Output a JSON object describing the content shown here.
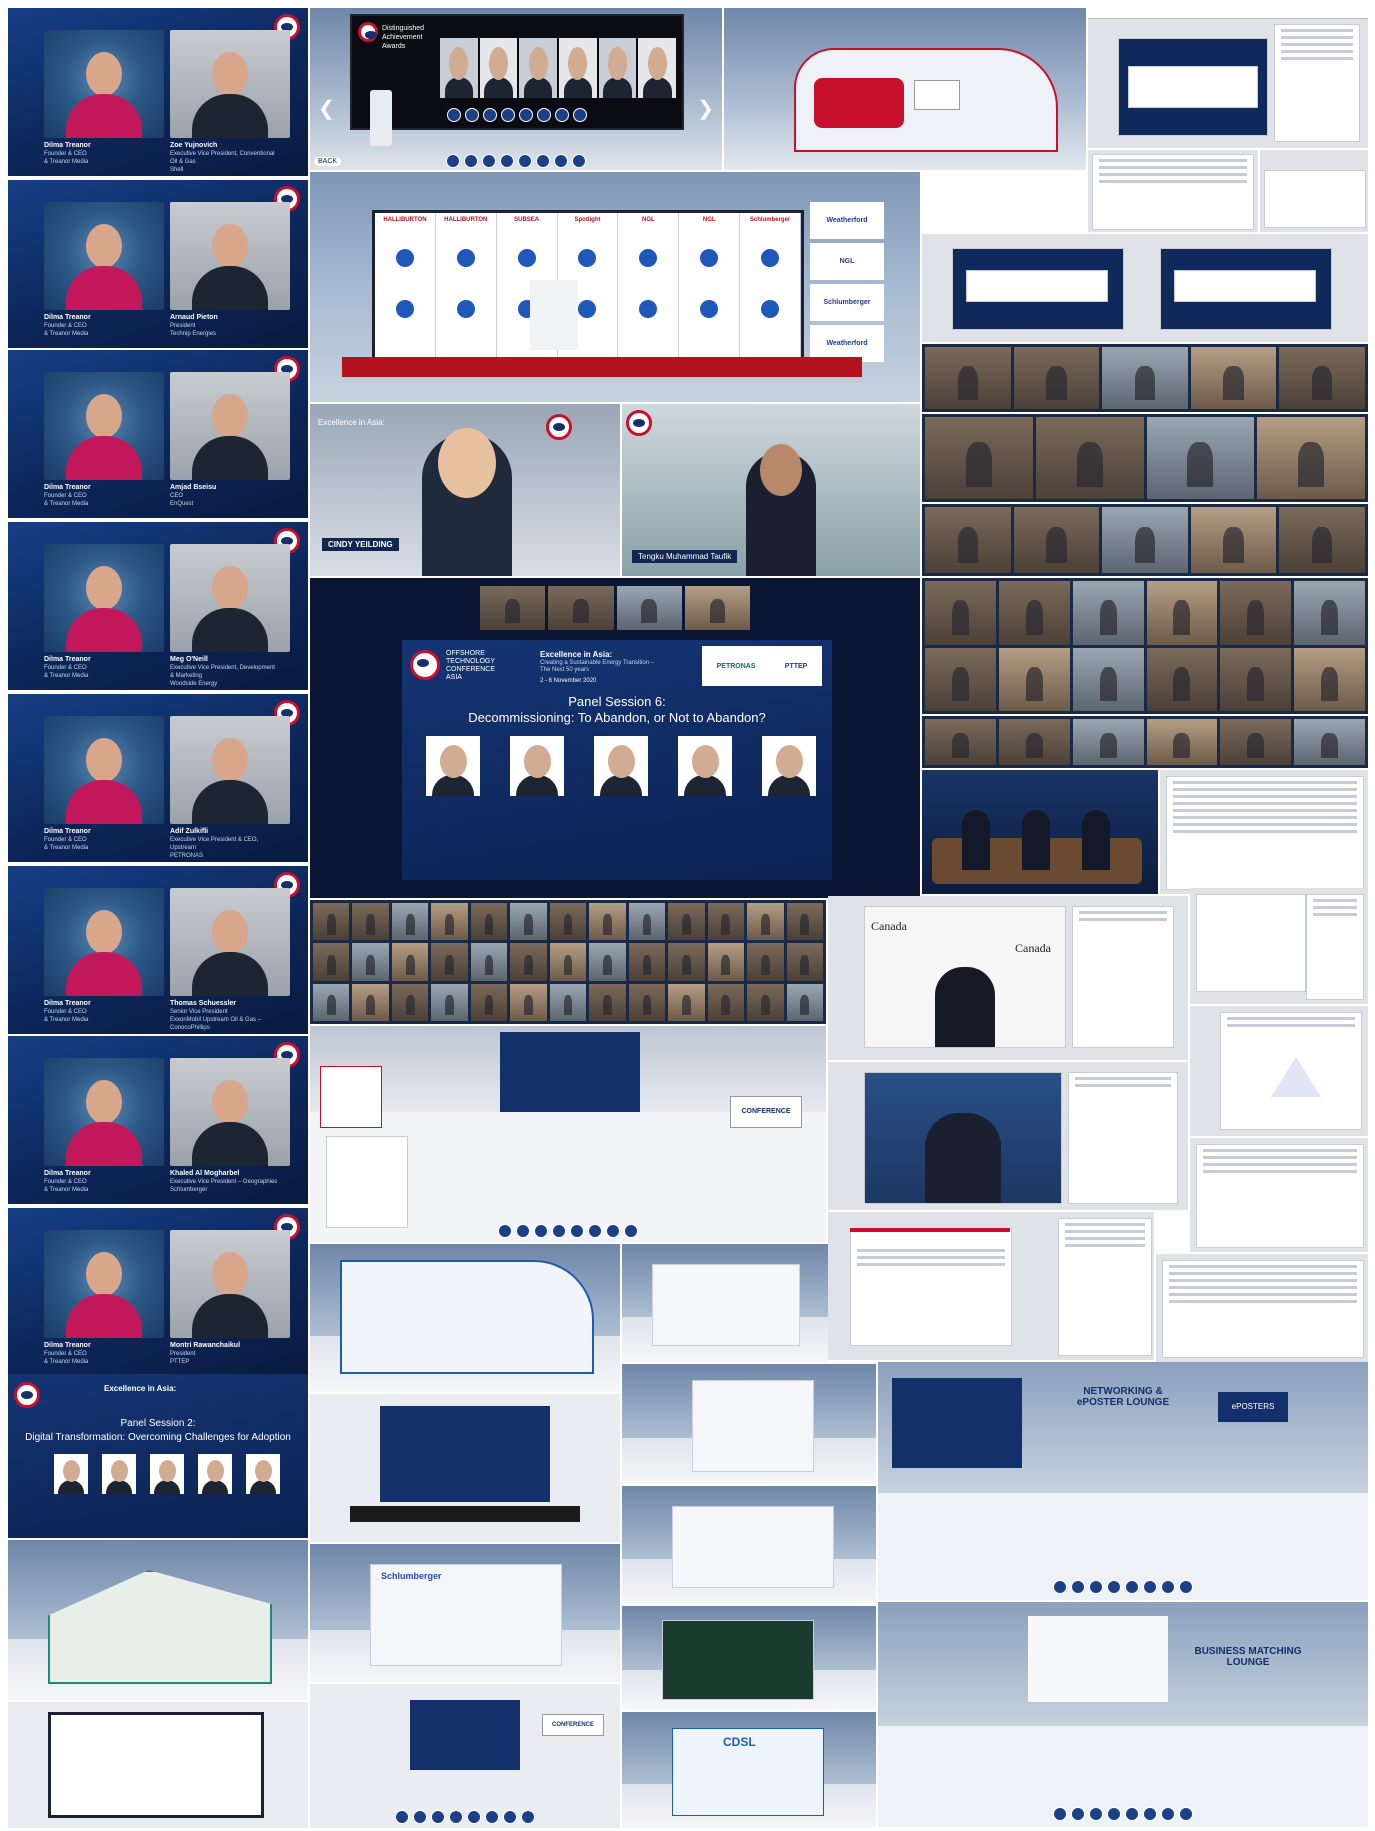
{
  "interviews": [
    {
      "host": "Dilma Treanor",
      "host_role": "Founder & CEO",
      "host_org": "& Treanor Media",
      "guest": "Zoe Yujnovich",
      "guest_role": "Executive Vice President, Conventional Oil & Gas",
      "guest_org": "Shell"
    },
    {
      "host": "Dilma Treanor",
      "host_role": "Founder & CEO",
      "host_org": "& Treanor Media",
      "guest": "Arnaud Pieton",
      "guest_role": "President",
      "guest_org": "Technip Energies"
    },
    {
      "host": "Dilma Treanor",
      "host_role": "Founder & CEO",
      "host_org": "& Treanor Media",
      "guest": "Amjad Bseisu",
      "guest_role": "CEO",
      "guest_org": "EnQuest"
    },
    {
      "host": "Dilma Treanor",
      "host_role": "Founder & CEO",
      "host_org": "& Treanor Media",
      "guest": "Meg O'Neill",
      "guest_role": "Executive Vice President, Development & Marketing",
      "guest_org": "Woodside Energy"
    },
    {
      "host": "Dilma Treanor",
      "host_role": "Founder & CEO",
      "host_org": "& Treanor Media",
      "guest": "Adif Zulkifli",
      "guest_role": "Executive Vice President & CEO, Upstream",
      "guest_org": "PETRONAS"
    },
    {
      "host": "Dilma Treanor",
      "host_role": "Founder & CEO",
      "host_org": "& Treanor Media",
      "guest": "Thomas Schuessler",
      "guest_role": "Senior Vice President",
      "guest_org": "ExxonMobil Upstream Oil & Gas – ConocoPhillips"
    },
    {
      "host": "Dilma Treanor",
      "host_role": "Founder & CEO",
      "host_org": "& Treanor Media",
      "guest": "Khaled Al Mogharbel",
      "guest_role": "Executive Vice President – Geographies",
      "guest_org": "Schlumberger"
    },
    {
      "host": "Dilma Treanor",
      "host_role": "Founder & CEO",
      "host_org": "& Treanor Media",
      "guest": "Montri Rawanchaikul",
      "guest_role": "President",
      "guest_org": "PTTEP"
    }
  ],
  "top_hall": {
    "banner": "Distinguished Achievement Awards",
    "back_label": "BACK"
  },
  "stage_wall": {
    "columns": [
      "HALLIBURTON",
      "HALLIBURTON",
      "SUBSEA",
      "Spotlight",
      "NGL",
      "NGL",
      "Schlumberger"
    ],
    "side": [
      "Weatherford",
      "NGL",
      "Schlumberger",
      "Weatherford"
    ]
  },
  "keynotes": [
    {
      "name": "CINDY YEILDING",
      "event": "Excellence in Asia:"
    },
    {
      "name": "Tengku Muhammad Taufik",
      "event": ""
    }
  ],
  "panel6": {
    "brand": [
      "OFFSHORE",
      "TECHNOLOGY",
      "CONFERENCE",
      "ASIA"
    ],
    "event": "Excellence in Asia:",
    "event_sub": "Creating a Sustainable Energy Transition – The Next 50 years",
    "dates": "2 - 6 November 2020",
    "title_line1": "Panel Session 6:",
    "title_line2": "Decommissioning: To Abandon, or Not to Abandon?",
    "sponsor_logos": [
      "PETRONAS",
      "PTTEP"
    ]
  },
  "panel2": {
    "event": "Excellence in Asia:",
    "title_line1": "Panel Session 2:",
    "title_line2": "Digital Transformation: Overcoming Challenges for Adoption"
  },
  "canada_tile": {
    "wordmark": "Canada"
  },
  "lounges": [
    {
      "title_line1": "NETWORKING &",
      "title_line2": "ePOSTER LOUNGE",
      "sign": "ePOSTERS"
    },
    {
      "title_line1": "BUSINESS MATCHING",
      "title_line2": "LOUNGE",
      "sign": ""
    }
  ],
  "booths": {
    "schlumberger": "Schlumberger",
    "cdsl": "CDSL",
    "conference_sign": "CONFERENCE"
  },
  "colors": {
    "otc_navy": "#0d2a5c",
    "otc_red": "#c8102e",
    "page": "#ffffff"
  }
}
